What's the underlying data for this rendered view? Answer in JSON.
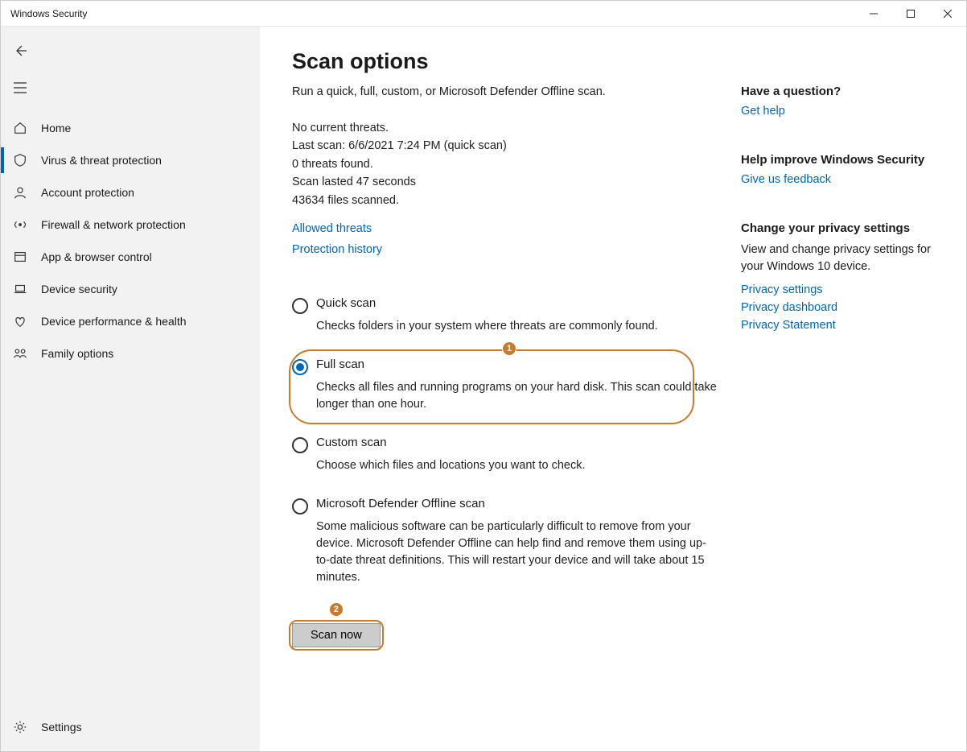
{
  "window": {
    "title": "Windows Security"
  },
  "sidebar": {
    "items": [
      {
        "label": "Home"
      },
      {
        "label": "Virus & threat protection"
      },
      {
        "label": "Account protection"
      },
      {
        "label": "Firewall & network protection"
      },
      {
        "label": "App & browser control"
      },
      {
        "label": "Device security"
      },
      {
        "label": "Device performance & health"
      },
      {
        "label": "Family options"
      }
    ],
    "settings": "Settings"
  },
  "page": {
    "title": "Scan options",
    "subtitle": "Run a quick, full, custom, or Microsoft Defender Offline scan.",
    "status": {
      "no_threats": "No current threats.",
      "last_scan": "Last scan: 6/6/2021 7:24 PM (quick scan)",
      "threats_found": "0 threats found.",
      "duration": "Scan lasted 47 seconds",
      "files_scanned": "43634 files scanned."
    },
    "links": {
      "allowed_threats": "Allowed threats",
      "protection_history": "Protection history"
    },
    "scan": {
      "quick": {
        "label": "Quick scan",
        "desc": "Checks folders in your system where threats are commonly found."
      },
      "full": {
        "label": "Full scan",
        "desc": "Checks all files and running programs on your hard disk. This scan could take longer than one hour."
      },
      "custom": {
        "label": "Custom scan",
        "desc": "Choose which files and locations you want to check."
      },
      "offline": {
        "label": "Microsoft Defender Offline scan",
        "desc": "Some malicious software can be particularly difficult to remove from your device. Microsoft Defender Offline can help find and remove them using up-to-date threat definitions. This will restart your device and will take about 15 minutes."
      },
      "selected": "full"
    },
    "scan_now": "Scan now"
  },
  "aside": {
    "question": {
      "heading": "Have a question?",
      "link": "Get help"
    },
    "improve": {
      "heading": "Help improve Windows Security",
      "link": "Give us feedback"
    },
    "privacy": {
      "heading": "Change your privacy settings",
      "text": "View and change privacy settings for your Windows 10 device.",
      "links": {
        "settings": "Privacy settings",
        "dashboard": "Privacy dashboard",
        "statement": "Privacy Statement"
      }
    }
  },
  "annotations": {
    "badge1": "1",
    "badge2": "2"
  }
}
